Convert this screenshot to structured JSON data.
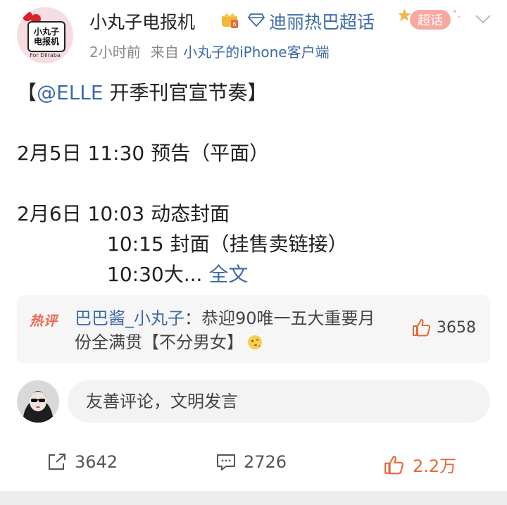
{
  "post": {
    "author": {
      "name": "小丸子电报机",
      "avatar_text_line1": "小丸子",
      "avatar_text_line2": "电报机",
      "avatar_caption": "For Dilraba"
    },
    "topic": "迪丽热巴超话",
    "supertopic_badge": "超话",
    "meta": {
      "time": "2小时前",
      "from_prefix": "来自",
      "source": "小丸子的iPhone客户端"
    },
    "lines": {
      "l1_bracket_open": "【",
      "l1_mention": "@ELLE",
      "l1_rest": " 开季刊官宣节奏】",
      "l2": "2月5日 11:30 预告（平面）",
      "l3": "2月6日 10:03 动态封面",
      "l4": "10:15 封面（挂售卖链接）",
      "l5_text": "10:30大...",
      "l5_link": "全文"
    }
  },
  "hot_comment": {
    "tag": "热评",
    "user": "巴巴酱_小丸子",
    "separator": "：",
    "text": "恭迎90唯一五大重要月份全满贯【不分男女】",
    "likes": "3658"
  },
  "comment_input": {
    "placeholder": "友善评论，文明发言"
  },
  "actions": {
    "reposts": "3642",
    "comments": "2726",
    "likes": "2.2万"
  },
  "colors": {
    "link_blue": "#3d6aa8",
    "hot_orange": "#f0664e",
    "like_orange": "#e8663a"
  }
}
